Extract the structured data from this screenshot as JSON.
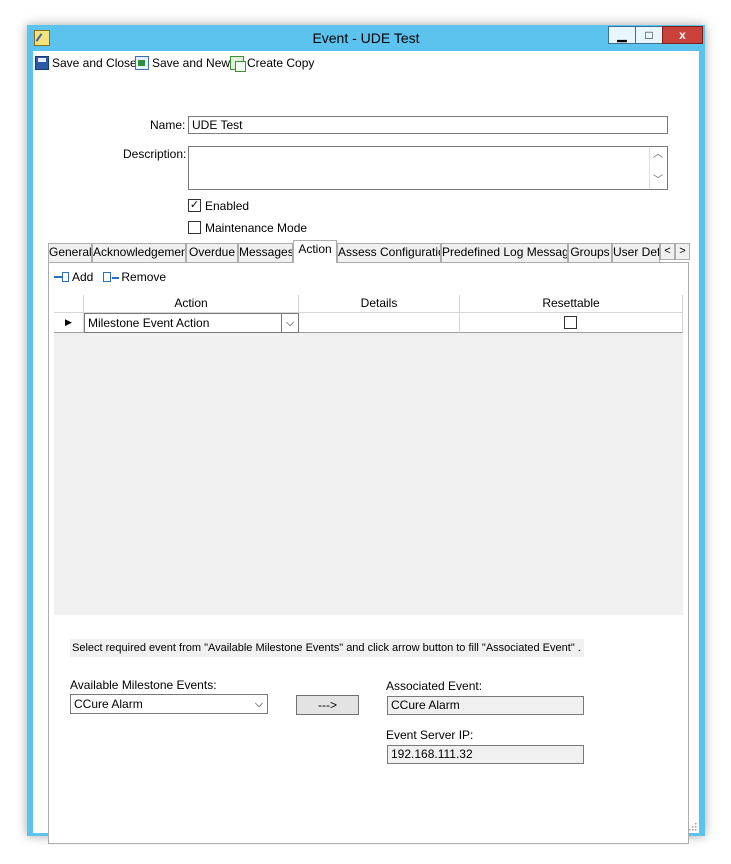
{
  "window": {
    "title": "Event  -  UDE Test",
    "min_glyph": "▁",
    "max_glyph": "□",
    "close_glyph": "x"
  },
  "toolbar": {
    "save_close": "Save and Close",
    "save_new": "Save and New",
    "create_copy": "Create Copy"
  },
  "form": {
    "name_label": "Name:",
    "name_value": "UDE Test",
    "description_label": "Description:",
    "description_value": "",
    "enabled_label": "Enabled",
    "enabled_checked": true,
    "enabled_mark": "✓",
    "maintenance_label": "Maintenance Mode",
    "maintenance_checked": false
  },
  "tabs": [
    {
      "label": "General"
    },
    {
      "label": "Acknowledgement"
    },
    {
      "label": "Overdue"
    },
    {
      "label": "Messages"
    },
    {
      "label": "Action",
      "active": true
    },
    {
      "label": "Assess Configuration"
    },
    {
      "label": "Predefined Log Messages"
    },
    {
      "label": "Groups"
    },
    {
      "label": "User Def"
    }
  ],
  "tab_scroll": {
    "left": "<",
    "right": ">"
  },
  "action_tab": {
    "add_label": "Add",
    "remove_label": "Remove",
    "columns": [
      "Action",
      "Details",
      "Resettable"
    ],
    "rows": [
      {
        "indicator": "▶",
        "action": "Milestone Event Action",
        "details": "",
        "resettable": false
      }
    ],
    "combo_arrow": "⌵",
    "info_text": "Select required event from \"Available Milestone Events\" and click arrow button to fill \"Associated Event\" .",
    "available_label": "Available Milestone Events:",
    "available_value": "CCure Alarm",
    "arrow_button": "--->",
    "associated_label": "Associated Event:",
    "associated_value": "CCure Alarm",
    "server_ip_label": "Event Server IP:",
    "server_ip_value": "192.168.111.32"
  },
  "colors": {
    "window_frame": "#5bc3ee",
    "close_button": "#c8423b",
    "panel_bg": "#f0f0f0"
  }
}
